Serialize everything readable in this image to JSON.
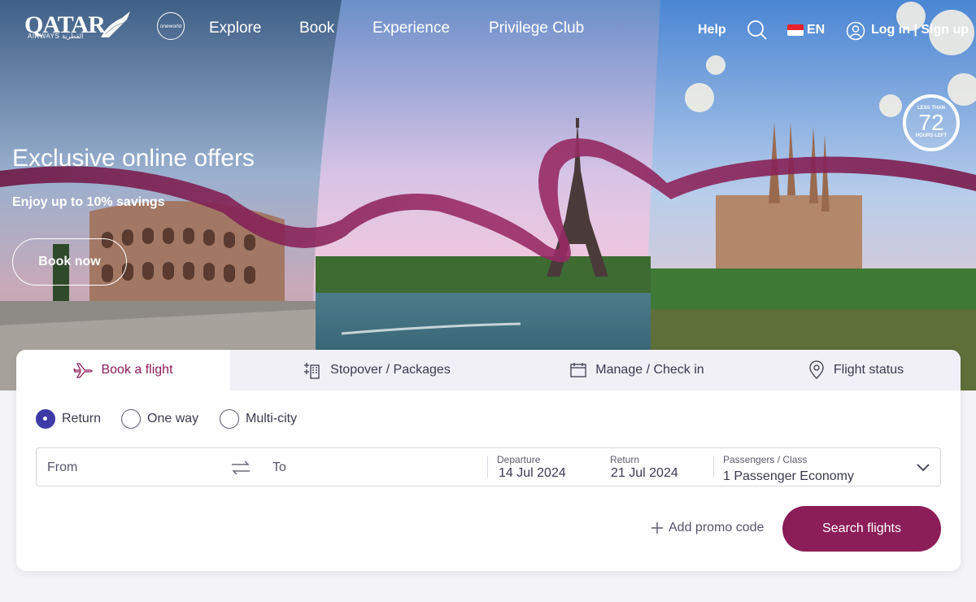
{
  "nav": {
    "logo_text": "QATAR",
    "logo_sub": "AIRWAYS القطرية",
    "oneworld": "oneworld",
    "items": [
      "Explore",
      "Book",
      "Experience",
      "Privilege Club"
    ],
    "help": "Help",
    "lang": "EN",
    "login": "Log in | Sign up"
  },
  "hero": {
    "title": "Exclusive online offers",
    "subtitle": "Enjoy up to 10% savings",
    "cta": "Book now",
    "badge": {
      "top": "LESS THAN",
      "number": "72",
      "bottom": "HOURS LEFT"
    }
  },
  "booking": {
    "tabs": [
      {
        "label": "Book a flight",
        "icon": "plane-icon"
      },
      {
        "label": "Stopover / Packages",
        "icon": "building-plane-icon"
      },
      {
        "label": "Manage / Check in",
        "icon": "calendar-icon"
      },
      {
        "label": "Flight status",
        "icon": "location-pin-icon"
      }
    ],
    "trip_types": [
      "Return",
      "One way",
      "Multi-city"
    ],
    "selected_trip": "Return",
    "from_placeholder": "From",
    "to_placeholder": "To",
    "departure_label": "Departure",
    "departure_value": "14 Jul 2024",
    "return_label": "Return",
    "return_value": "21 Jul 2024",
    "pax_label": "Passengers / Class",
    "pax_value": "1  Passenger Economy",
    "promo": "Add promo code",
    "search": "Search flights"
  },
  "colors": {
    "brand": "#8b1d58",
    "radio_selected": "#3d3aa8",
    "panel_bg": "#ffffff",
    "tabs_bg": "#f0f0f6"
  }
}
